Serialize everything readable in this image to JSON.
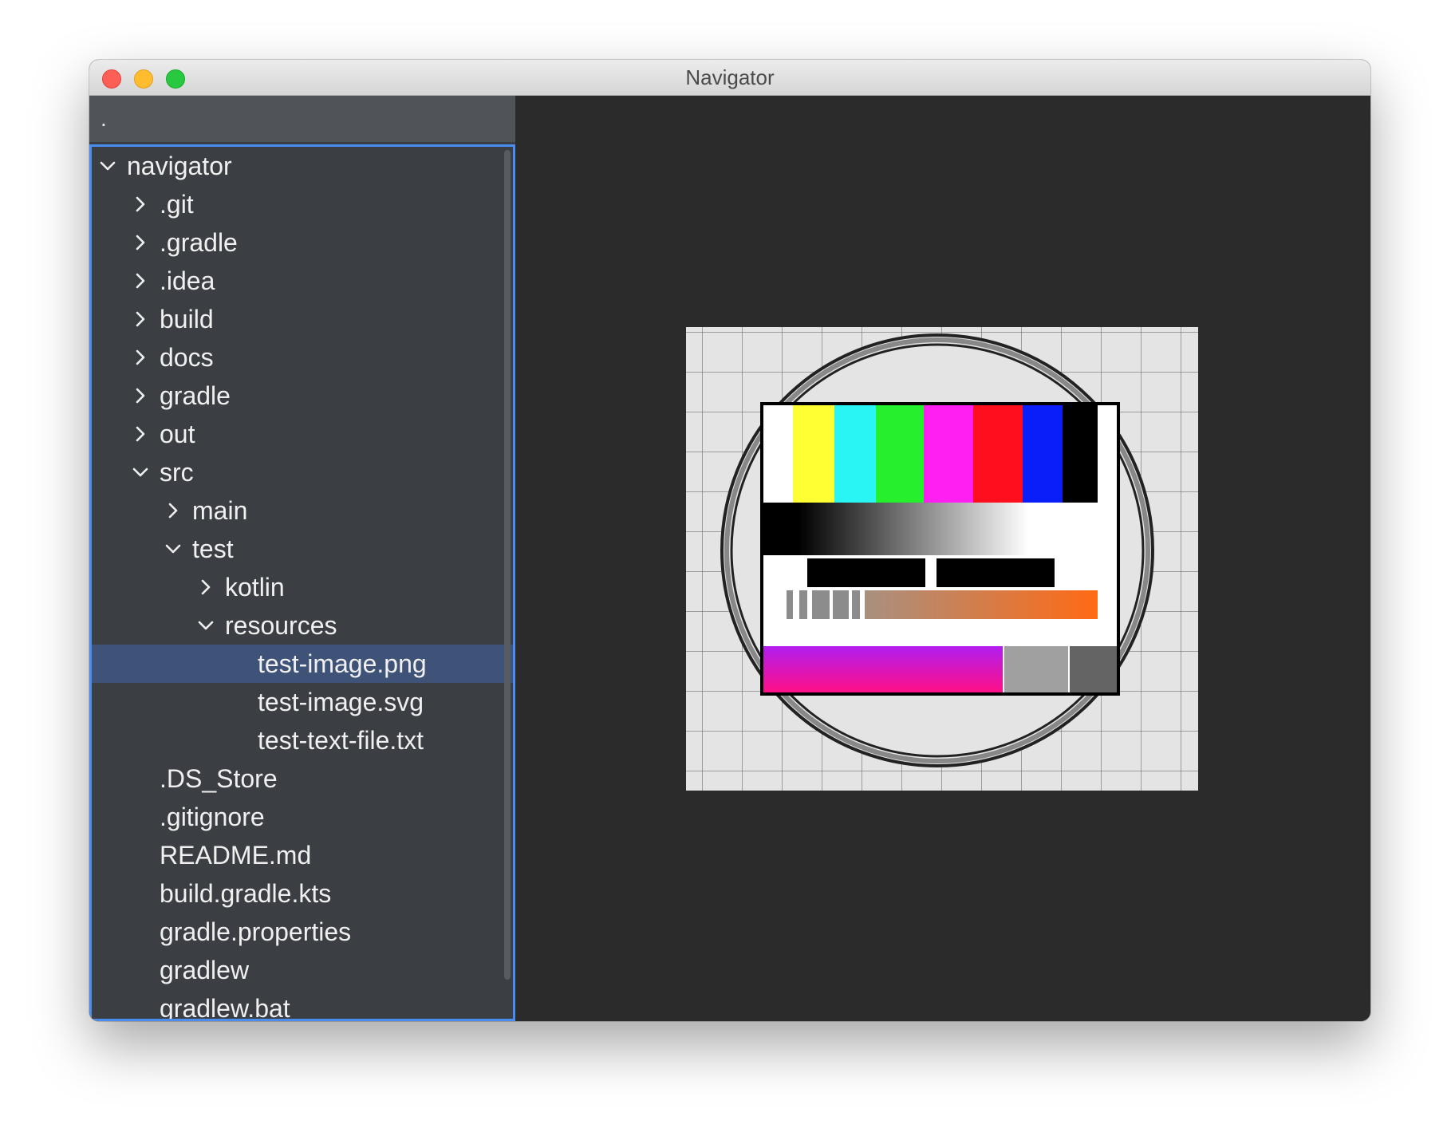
{
  "window": {
    "title": "Navigator"
  },
  "path_bar": {
    "text": "."
  },
  "tree": {
    "selected_index": 13,
    "items": [
      {
        "label": "navigator",
        "level": 0,
        "expander": "expanded"
      },
      {
        "label": ".git",
        "level": 1,
        "expander": "collapsed"
      },
      {
        "label": ".gradle",
        "level": 1,
        "expander": "collapsed"
      },
      {
        "label": ".idea",
        "level": 1,
        "expander": "collapsed"
      },
      {
        "label": "build",
        "level": 1,
        "expander": "collapsed"
      },
      {
        "label": "docs",
        "level": 1,
        "expander": "collapsed"
      },
      {
        "label": "gradle",
        "level": 1,
        "expander": "collapsed"
      },
      {
        "label": "out",
        "level": 1,
        "expander": "collapsed"
      },
      {
        "label": "src",
        "level": 1,
        "expander": "expanded"
      },
      {
        "label": "main",
        "level": 2,
        "expander": "collapsed"
      },
      {
        "label": "test",
        "level": 2,
        "expander": "expanded"
      },
      {
        "label": "kotlin",
        "level": 3,
        "expander": "collapsed"
      },
      {
        "label": "resources",
        "level": 3,
        "expander": "expanded"
      },
      {
        "label": "test-image.png",
        "level": 4,
        "expander": "none"
      },
      {
        "label": "test-image.svg",
        "level": 4,
        "expander": "none"
      },
      {
        "label": "test-text-file.txt",
        "level": 4,
        "expander": "none"
      },
      {
        "label": ".DS_Store",
        "level": 1,
        "expander": "none"
      },
      {
        "label": ".gitignore",
        "level": 1,
        "expander": "none"
      },
      {
        "label": "README.md",
        "level": 1,
        "expander": "none"
      },
      {
        "label": "build.gradle.kts",
        "level": 1,
        "expander": "none"
      },
      {
        "label": "gradle.properties",
        "level": 1,
        "expander": "none"
      },
      {
        "label": "gradlew",
        "level": 1,
        "expander": "none"
      },
      {
        "label": "gradlew.bat",
        "level": 1,
        "expander": "none"
      }
    ]
  },
  "colors": {
    "selection": "#3f5277",
    "focus_border": "#4a8cf0",
    "sidebar_bg": "#3b3e43",
    "preview_bg": "#2b2b2b"
  },
  "preview": {
    "image": "test-card-image"
  }
}
